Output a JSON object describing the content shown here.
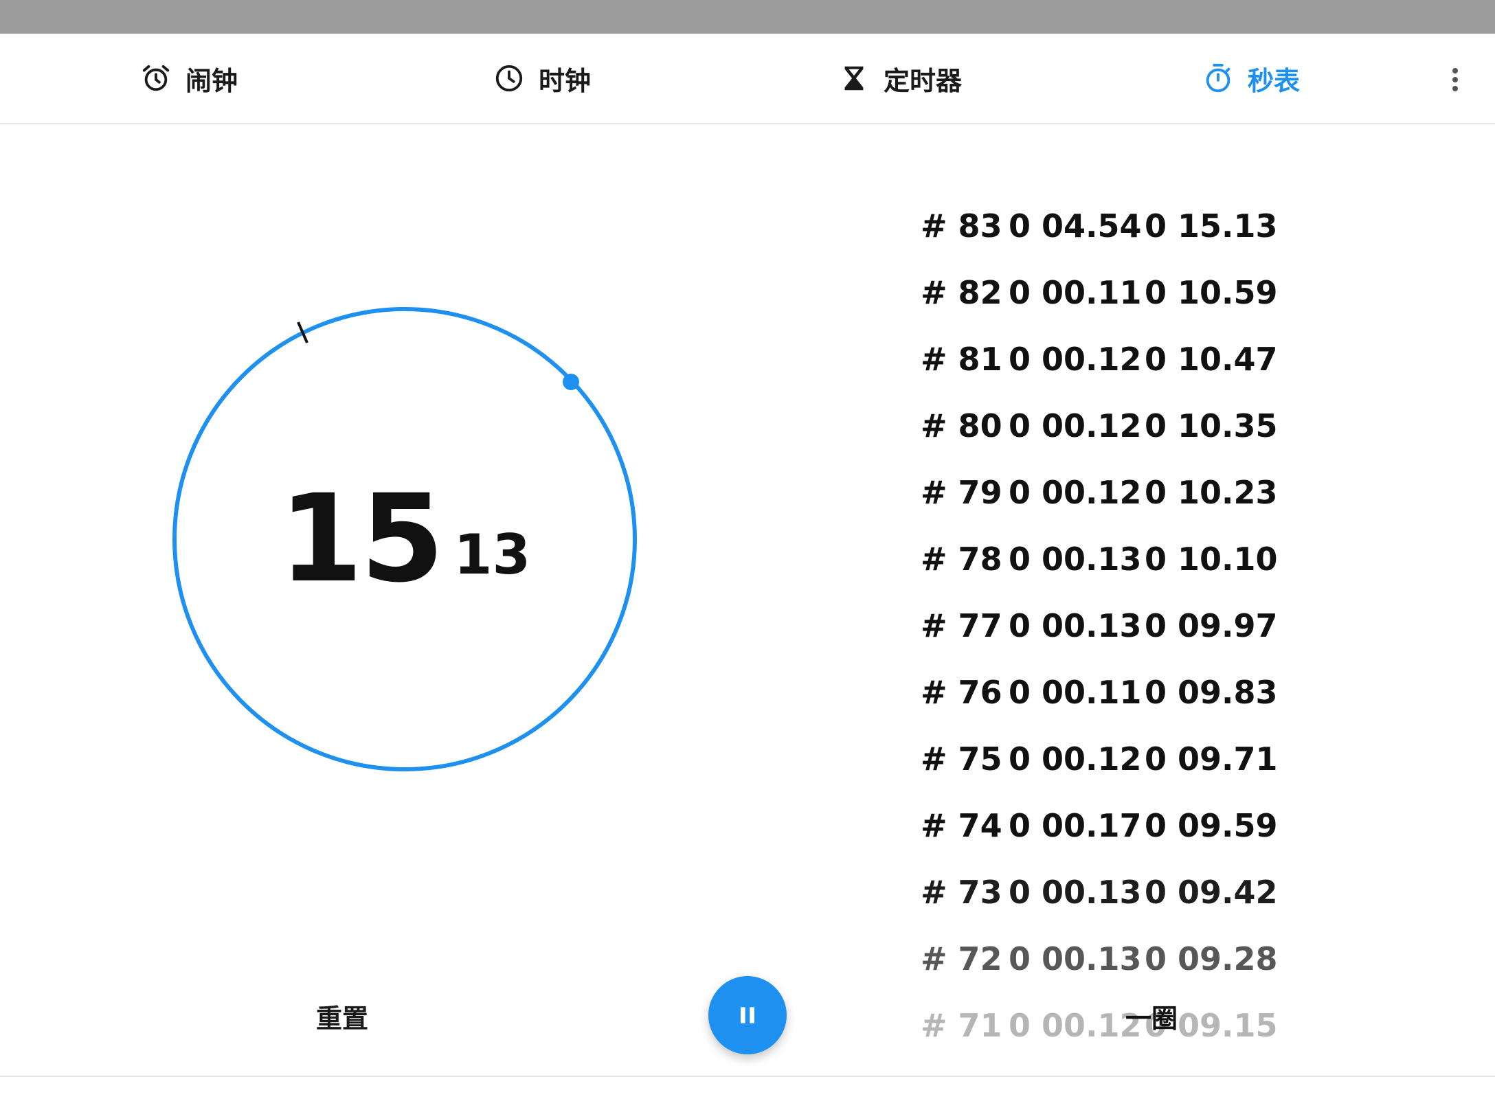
{
  "tabs": [
    {
      "label": "闹钟",
      "icon": "alarm-clock-icon"
    },
    {
      "label": "时钟",
      "icon": "clock-icon"
    },
    {
      "label": "定时器",
      "icon": "hourglass-icon"
    },
    {
      "label": "秒表",
      "icon": "stopwatch-icon",
      "active": true
    }
  ],
  "menu": {
    "icon": "more-vertical-icon"
  },
  "stopwatch": {
    "seconds": "15",
    "centiseconds": "13",
    "accent_color": "#1e90f0"
  },
  "laps": [
    {
      "num": "# 83",
      "lap": "0 04.54",
      "total": "0 15.13"
    },
    {
      "num": "# 82",
      "lap": "0 00.11",
      "total": "0 10.59"
    },
    {
      "num": "# 81",
      "lap": "0 00.12",
      "total": "0 10.47"
    },
    {
      "num": "# 80",
      "lap": "0 00.12",
      "total": "0 10.35"
    },
    {
      "num": "# 79",
      "lap": "0 00.12",
      "total": "0 10.23"
    },
    {
      "num": "# 78",
      "lap": "0 00.13",
      "total": "0 10.10"
    },
    {
      "num": "# 77",
      "lap": "0 00.13",
      "total": "0 09.97"
    },
    {
      "num": "# 76",
      "lap": "0 00.11",
      "total": "0 09.83"
    },
    {
      "num": "# 75",
      "lap": "0 00.12",
      "total": "0 09.71"
    },
    {
      "num": "# 74",
      "lap": "0 00.17",
      "total": "0 09.59"
    },
    {
      "num": "# 73",
      "lap": "0 00.13",
      "total": "0 09.42"
    },
    {
      "num": "# 72",
      "lap": "0 00.13",
      "total": "0 09.28"
    },
    {
      "num": "# 71",
      "lap": "0 00.12",
      "total": "0 09.15"
    }
  ],
  "controls": {
    "reset_label": "重置",
    "lap_label": "一圈",
    "pause_icon": "pause-icon"
  }
}
